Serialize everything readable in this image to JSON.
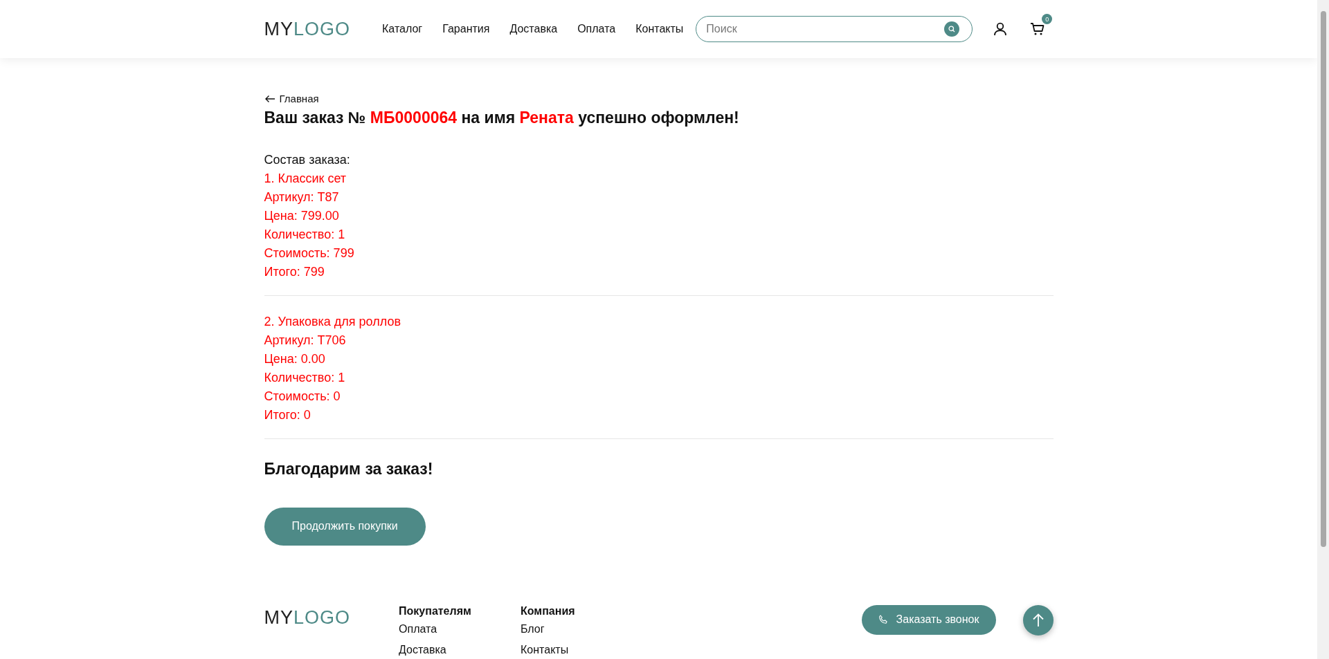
{
  "header": {
    "logo": {
      "part_1": "MY",
      "part_2": "LOGO"
    },
    "nav": [
      "Каталог",
      "Гарантия",
      "Доставка",
      "Оплата",
      "Контакты"
    ],
    "search": {
      "placeholder": "Поиск"
    },
    "cart_count": "0"
  },
  "breadcrumb": "Главная",
  "heading": [
    {
      "text": "Ваш заказ № ",
      "highlight": false
    },
    {
      "text": "МБ0000064",
      "highlight": true
    },
    {
      "text": " на имя ",
      "highlight": false
    },
    {
      "text": "Рената",
      "highlight": true
    },
    {
      "text": " успешно оформлен!",
      "highlight": false
    }
  ],
  "order": {
    "label": "Состав заказа:",
    "items": [
      {
        "lines": [
          "1. Классик сет",
          "Артикул: Т87",
          "Цена: 799.00",
          "Количество: 1",
          "Стоимость: 799",
          "Итого: 799"
        ]
      },
      {
        "lines": [
          "2. Упаковка для роллов",
          "Артикул: Т706",
          "Цена: 0.00",
          "Количество: 1",
          "Стоимость: 0",
          "Итого: 0"
        ]
      }
    ]
  },
  "thanks": "Благодарим за заказ!",
  "continue_button": "Продолжить покупки",
  "footer": {
    "logo": {
      "part_1": "MY",
      "part_2": "LOGO"
    },
    "columns": [
      {
        "title": "Покупателям",
        "links": [
          "Оплата",
          "Доставка"
        ]
      },
      {
        "title": "Компания",
        "links": [
          "Блог",
          "Контакты"
        ]
      }
    ],
    "callback_button": "Заказать звонок"
  }
}
